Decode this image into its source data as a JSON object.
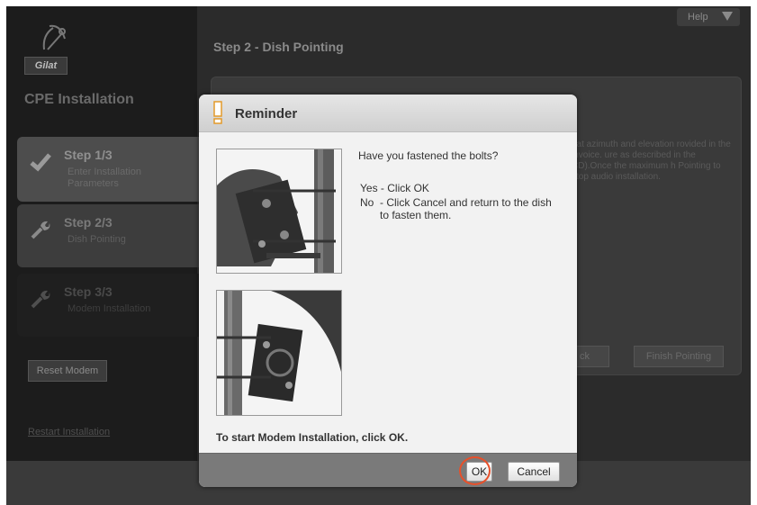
{
  "app": {
    "logo_text": "Gilat",
    "title": "CPE Installation",
    "help_label": "Help"
  },
  "sidebar": {
    "steps": [
      {
        "label": "Step 1/3",
        "sublabel": "Enter Installation Parameters",
        "icon": "check-icon",
        "state": "completed"
      },
      {
        "label": "Step 2/3",
        "sublabel": "Dish Pointing",
        "icon": "wrench-icon",
        "state": "current"
      },
      {
        "label": "Step 3/3",
        "sublabel": "Modem Installation",
        "icon": "wrench-icon",
        "state": "pending"
      }
    ],
    "reset_label": "Reset Modem",
    "restart_label": "Restart Installation"
  },
  "main": {
    "page_title": "Step 2 - Dish Pointing",
    "background_text": "hat azimuth and elevation rovided in the invoice. ure as described in the CD).Once the maximum h Pointing to stop audio installation.",
    "back_label": "ck",
    "finish_label": "Finish Pointing"
  },
  "dialog": {
    "title": "Reminder",
    "icon": "warning-icon",
    "question": "Have you fastened the bolts?",
    "option_yes": "Yes - Click OK",
    "option_no_key": "No",
    "option_no_text": "- Click Cancel and return to the dish to fasten them.",
    "instruction": "To start Modem Installation, click OK.",
    "ok_label": "OK",
    "cancel_label": "Cancel",
    "highlight_color": "#e8502a"
  }
}
